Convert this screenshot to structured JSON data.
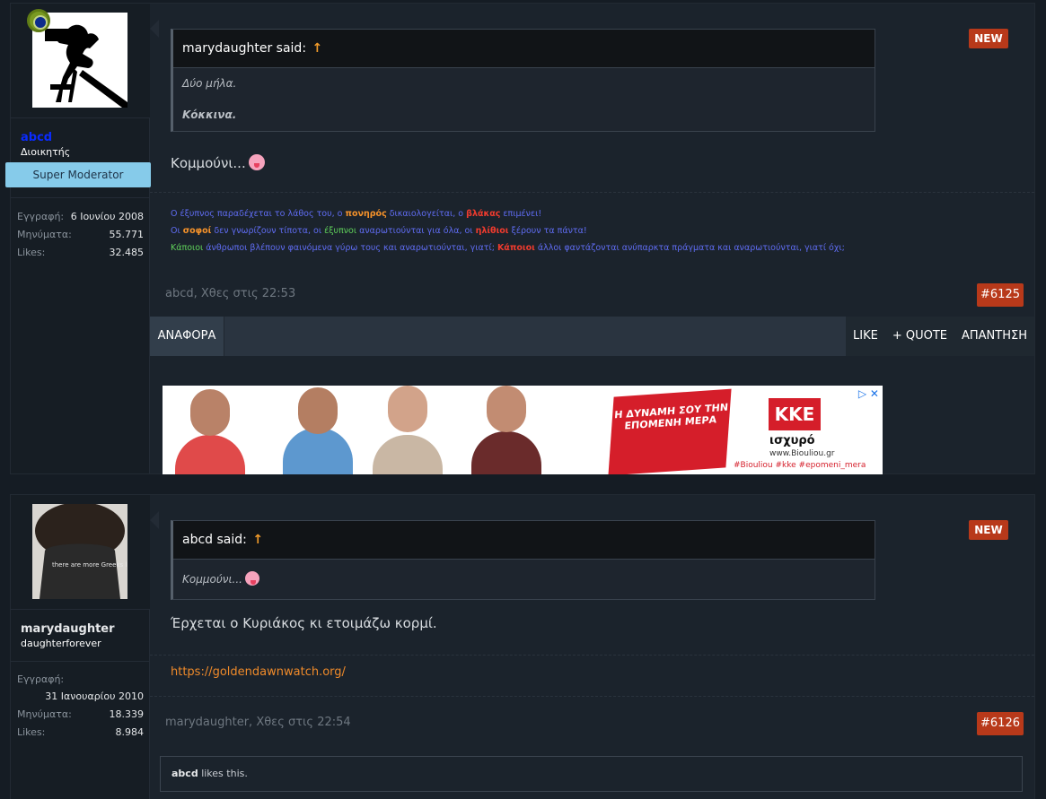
{
  "posts": [
    {
      "user": {
        "name": "abcd",
        "title": "Διοικητής",
        "banner": "Super Moderator",
        "avatar_icon": "cameraman-silhouette-icon",
        "name_color": "#0a2bff",
        "stats": [
          {
            "label": "Εγγραφή:",
            "value": "6 Ιουνίου 2008"
          },
          {
            "label": "Μηνύματα:",
            "value": "55.771"
          },
          {
            "label": "Likes:",
            "value": "32.485"
          }
        ]
      },
      "badge": "NEW",
      "quote": {
        "author": "marydaughter said:",
        "arrow": "↑",
        "lines": [
          "Δύο μήλα.",
          "Κόκκινα."
        ]
      },
      "message": "Κομμούνι...",
      "signature": {
        "line1": [
          {
            "t": "Ο έξυπνος παραδέχεται το λάθος του, ο ",
            "c": "blue"
          },
          {
            "t": "πονηρός",
            "c": "orange"
          },
          {
            "t": " δικαιολογείται, ο ",
            "c": "blue"
          },
          {
            "t": "βλάκας",
            "c": "red"
          },
          {
            "t": " επιμένει!",
            "c": "blue"
          }
        ],
        "line2": [
          {
            "t": "Οι ",
            "c": "blue"
          },
          {
            "t": "σοφοί",
            "c": "orange"
          },
          {
            "t": " δεν γνωρίζουν τίποτα, οι ",
            "c": "blue"
          },
          {
            "t": "έξυπνοι",
            "c": "green"
          },
          {
            "t": " αναρωτιούνται για όλα, οι ",
            "c": "blue"
          },
          {
            "t": "ηλίθιοι",
            "c": "red"
          },
          {
            "t": " ξέρουν τα πάντα!",
            "c": "blue"
          }
        ],
        "line3": [
          {
            "t": "Κάποιοι",
            "c": "green"
          },
          {
            "t": " άνθρωποι βλέπουν φαινόμενα γύρω τους και αναρωτιούνται, γιατί; ",
            "c": "blue"
          },
          {
            "t": "Κάποιοι",
            "c": "red"
          },
          {
            "t": " άλλοι φαντάζονται ανύπαρκτα πράγματα και αναρωτιούνται, γιατί όχι;",
            "c": "blue"
          }
        ]
      },
      "meta": "abcd, Χθες στις 22:53",
      "post_number": "#6125",
      "actions": {
        "report": "ΑΝΑΦΟΡΑ",
        "like": "LIKE",
        "quote": "+ QUOTE",
        "reply": "ΑΠΑΝΤΗΣΗ"
      }
    },
    {
      "user": {
        "name": "marydaughter",
        "title": "daughterforever",
        "avatar_icon": "curly-hair-person-avatar",
        "avatar_shirt_text": "there are more Greeks like me",
        "stats": [
          {
            "label": "Εγγραφή:",
            "value": "31 Ιανουαρίου 2010"
          },
          {
            "label": "Μηνύματα:",
            "value": "18.339"
          },
          {
            "label": "Likes:",
            "value": "8.984"
          }
        ]
      },
      "badge": "NEW",
      "quote": {
        "author": "abcd said:",
        "arrow": "↑",
        "lines": [
          "Κομμούνι..."
        ]
      },
      "message": "Έρχεται ο Κυριάκος κι ετοιμάζω κορμί.",
      "signature_link": "https://goldendawnwatch.org/",
      "meta": "marydaughter, Χθες στις 22:54",
      "post_number": "#6126",
      "likes": {
        "user": "abcd",
        "text": " likes this."
      }
    }
  ],
  "ad": {
    "banner_text": "Η ΔΥΝΑΜΗ ΣΟΥ ΤΗΝ ΕΠΟΜΕΝΗ ΜΕΡΑ",
    "logo": "ΚΚΕ",
    "subtitle": "ισχυρό",
    "url": "www.Biouliou.gr",
    "hashtags": "#Biouliou #kke #epomeni_mera",
    "close_label": "▷ ✕"
  },
  "colors": {
    "accent_badge": "#b8391a",
    "staff_banner": "#86cbea",
    "link": "#ef8a2a"
  }
}
